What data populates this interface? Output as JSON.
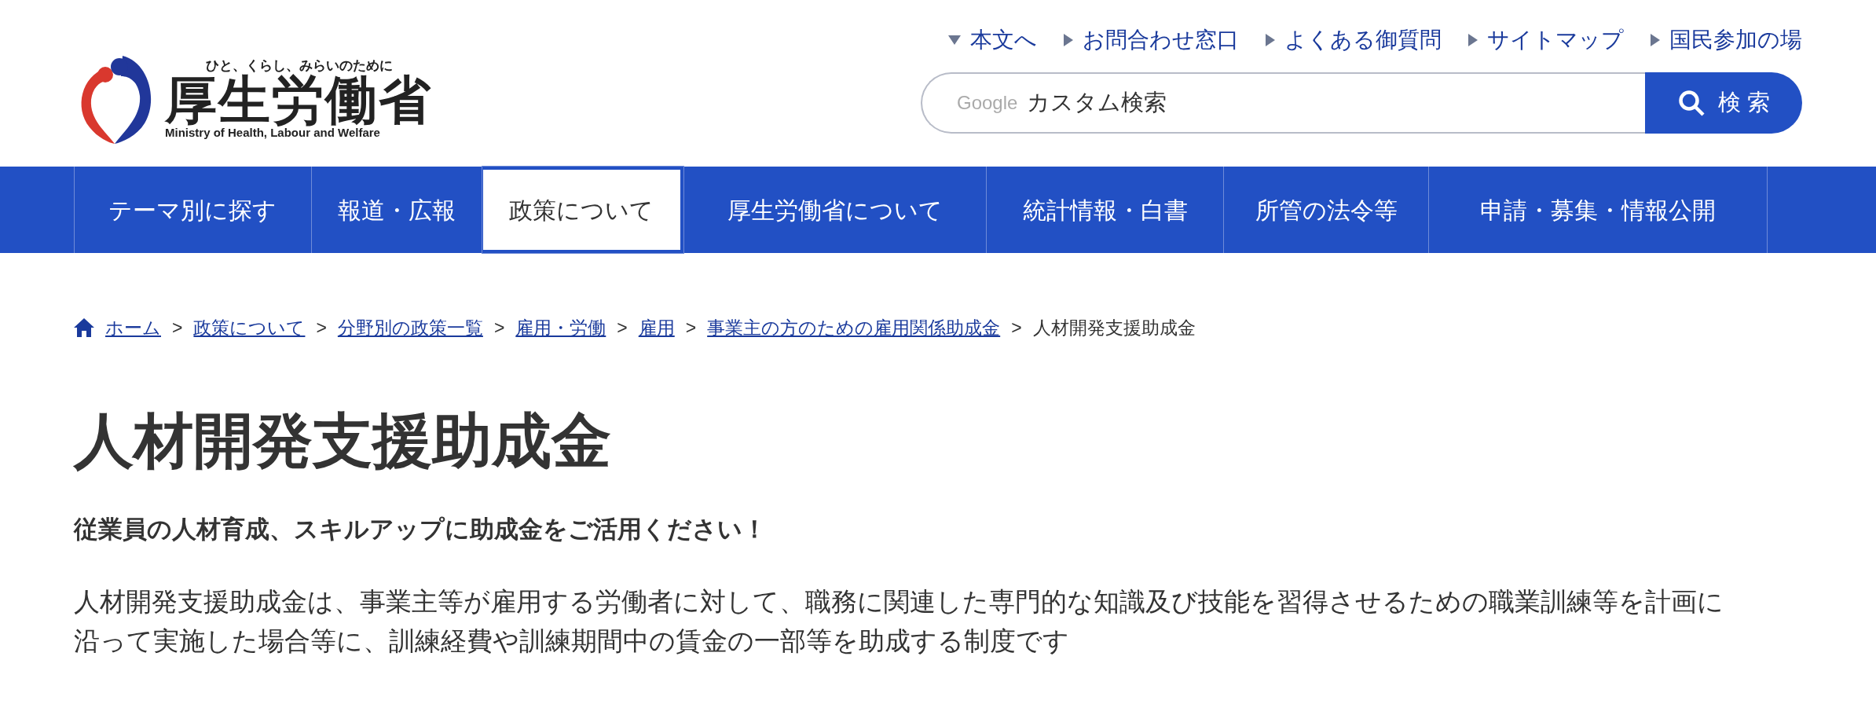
{
  "header": {
    "logo": {
      "tagline": "ひと、くらし、みらいのために",
      "name": "厚生労働省",
      "english": "Ministry of Health, Labour and Welfare"
    },
    "utility_links": [
      {
        "label": "本文へ",
        "kind": "down"
      },
      {
        "label": "お問合わせ窓口",
        "kind": "right"
      },
      {
        "label": "よくある御質問",
        "kind": "right"
      },
      {
        "label": "サイトマップ",
        "kind": "right"
      },
      {
        "label": "国民参加の場",
        "kind": "right"
      }
    ],
    "search": {
      "brand": "Google",
      "placeholder": "カスタム検索",
      "button": "検 索"
    }
  },
  "nav": [
    {
      "label": "テーマ別に探す",
      "selected": false
    },
    {
      "label": "報道・広報",
      "selected": false
    },
    {
      "label": "政策について",
      "selected": true
    },
    {
      "label": "厚生労働省について",
      "selected": false
    },
    {
      "label": "統計情報・白書",
      "selected": false
    },
    {
      "label": "所管の法令等",
      "selected": false
    },
    {
      "label": "申請・募集・情報公開",
      "selected": false
    }
  ],
  "breadcrumb": {
    "separator": ">",
    "items": [
      {
        "label": "ホーム",
        "link": true
      },
      {
        "label": "政策について",
        "link": true
      },
      {
        "label": "分野別の政策一覧",
        "link": true
      },
      {
        "label": "雇用・労働",
        "link": true
      },
      {
        "label": "雇用",
        "link": true
      },
      {
        "label": "事業主の方のための雇用関係助成金",
        "link": true
      },
      {
        "label": "人材開発支援助成金",
        "link": false
      }
    ]
  },
  "title": "人材開発支援助成金",
  "lead": "従業員の人材育成、スキルアップに助成金をご活用ください！",
  "body": "人材開発支援助成金は、事業主等が雇用する労働者に対して、職務に関連した専門的な知識及び技能を習得させるための職業訓練等を計画に沿って実施した場合等に、訓練経費や訓練期間中の賃金の一部等を助成する制度です"
}
